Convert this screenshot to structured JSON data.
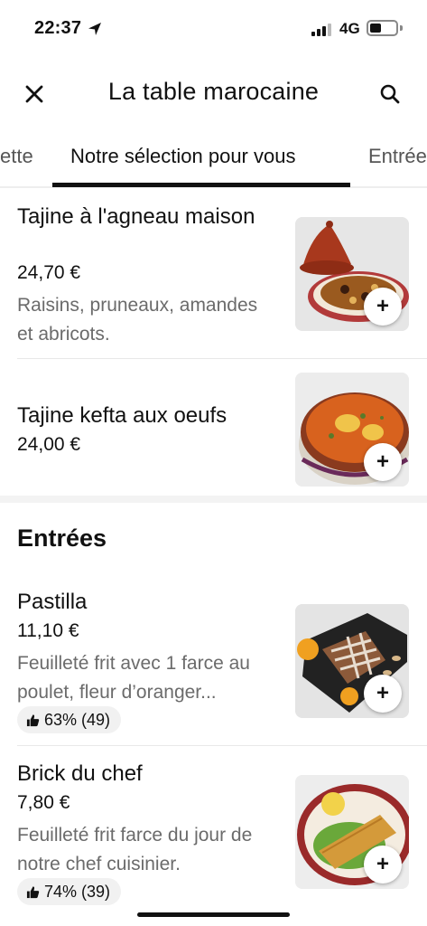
{
  "status_bar": {
    "time": "22:37",
    "network": "4G"
  },
  "header": {
    "title": "La table marocaine",
    "close_icon": "close-icon",
    "search_icon": "search-icon"
  },
  "tabs": [
    {
      "label": "ette"
    },
    {
      "label": "Notre sélection pour vous",
      "active": true
    },
    {
      "label": "Entrée"
    }
  ],
  "featured_items": [
    {
      "name": "Tajine à l'agneau maison",
      "price": "24,70 €",
      "description": "Raisins, pruneaux, amandes et abricots.",
      "image": "tajine-lamb"
    },
    {
      "name": "Tajine kefta aux oeufs",
      "price": "24,00 €",
      "image": "tajine-kefta"
    }
  ],
  "sections": [
    {
      "title": "Entrées",
      "items": [
        {
          "name": "Pastilla",
          "price": "11,10 €",
          "description": "Feuilleté frit avec 1 farce au poulet, fleur d’oranger...",
          "rating": "63% (49)",
          "image": "pastilla"
        },
        {
          "name": "Brick du chef",
          "price": "7,80 €",
          "description": "Feuilleté frit farce du jour de notre chef cuisinier.",
          "rating": "74% (39)",
          "image": "brick"
        }
      ]
    }
  ],
  "add_label": "+",
  "colors": {
    "text": "#111111",
    "muted": "#6b6b6b",
    "chip": "#f1f1f1",
    "divider": "#e8e8e8"
  }
}
